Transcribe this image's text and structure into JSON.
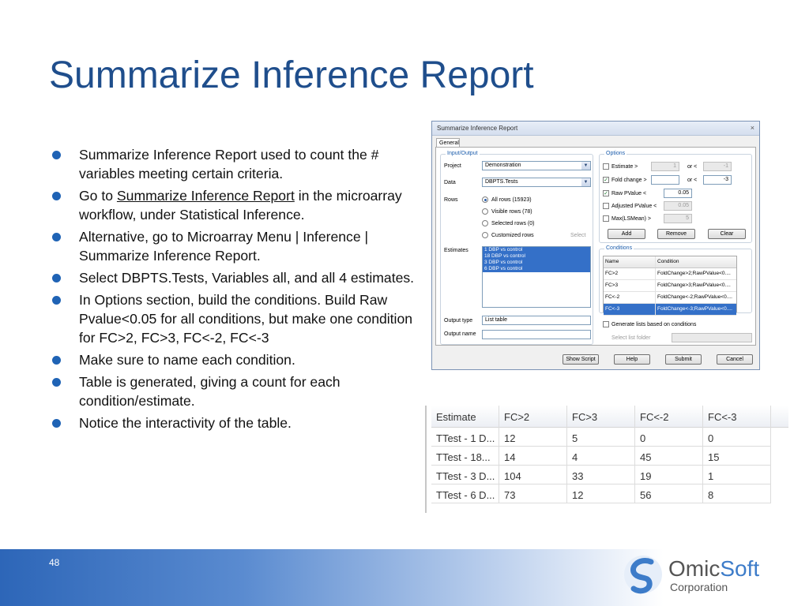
{
  "slide": {
    "title": "Summarize Inference Report",
    "page_number": "48"
  },
  "bullets": [
    {
      "text": "Summarize Inference Report used to count the # variables meeting certain criteria."
    },
    {
      "pre": "Go to ",
      "link": "Summarize Inference Report",
      "post": " in the microarray workflow, under Statistical Inference."
    },
    {
      "text": "Alternative, go to Microarray Menu | Inference | Summarize Inference Report."
    },
    {
      "text": "Select DBPTS.Tests, Variables all, and all 4 estimates."
    },
    {
      "text": "In Options section, build the conditions.  Build Raw Pvalue<0.05 for all conditions, but make one condition for FC>2, FC>3, FC<-2, FC<-3"
    },
    {
      "text": "Make sure to name each condition."
    },
    {
      "text": "Table is generated, giving a count for each condition/estimate."
    },
    {
      "text": "Notice the interactivity of the table."
    }
  ],
  "dialog": {
    "title": "Summarize Inference Report",
    "close": "×",
    "tab": "General",
    "input_output": {
      "legend": "Input/Output",
      "project_label": "Project",
      "project_value": "Demonstration",
      "data_label": "Data",
      "data_value": "DBPTS.Tests",
      "rows_label": "Rows",
      "rows_options": [
        "All rows (15923)",
        "Visible rows (78)",
        "Selected rows (0)",
        "Customized rows"
      ],
      "rows_select": "Select",
      "estimates_label": "Estimates",
      "estimates": [
        "1 DBP vs control",
        "18 DBP vs control",
        "3 DBP vs control",
        "6 DBP vs control"
      ],
      "output_type_label": "Output type",
      "output_type_value": "List table",
      "output_name_label": "Output name",
      "output_name_value": ""
    },
    "options": {
      "legend": "Options",
      "estimate_label": "Estimate >",
      "estimate_value": "1",
      "estimate_or": "or <",
      "estimate_or_value": "-1",
      "fold_label": "Fold change >",
      "fold_value": "",
      "fold_or": "or <",
      "fold_or_value": "-3",
      "raw_label": "Raw PValue <",
      "raw_value": "0.05",
      "adj_label": "Adjusted PValue <",
      "adj_value": "0.05",
      "max_label": "Max(LSMean) >",
      "max_value": "5",
      "add": "Add",
      "remove": "Remove",
      "clear": "Clear",
      "check_mark": "✓"
    },
    "conditions": {
      "legend": "Conditions",
      "headers": [
        "Name",
        "Condition"
      ],
      "rows": [
        [
          "FC>2",
          "FoldChange>2;RawPValue<0...."
        ],
        [
          "FC>3",
          "FoldChange>3;RawPValue<0...."
        ],
        [
          "FC<-2",
          "FoldChange<-2;RawPValue<0...."
        ],
        [
          "FC<-3",
          "FoldChange<-3;RawPValue<0...."
        ]
      ]
    },
    "generate_label": "Generate lists based on conditions",
    "select_folder_label": "Select list folder",
    "buttons": {
      "show_script": "Show Script",
      "help": "Help",
      "submit": "Submit",
      "cancel": "Cancel"
    }
  },
  "result_table": {
    "headers": [
      "Estimate",
      "FC>2",
      "FC>3",
      "FC<-2",
      "FC<-3"
    ],
    "rows": [
      [
        "TTest - 1 D...",
        "12",
        "5",
        "0",
        "0"
      ],
      [
        "TTest - 18...",
        "14",
        "4",
        "45",
        "15"
      ],
      [
        "TTest - 3 D...",
        "104",
        "33",
        "19",
        "1"
      ],
      [
        "TTest - 6 D...",
        "73",
        "12",
        "56",
        "8"
      ]
    ]
  },
  "logo": {
    "name_part1": "Omic",
    "name_part2": "Soft",
    "subtitle": "Corporation"
  },
  "colors": {
    "title": "#1f4e8c",
    "bullet": "#1f63b5",
    "selection": "#3470c8",
    "footer_start": "#2d66b8"
  }
}
